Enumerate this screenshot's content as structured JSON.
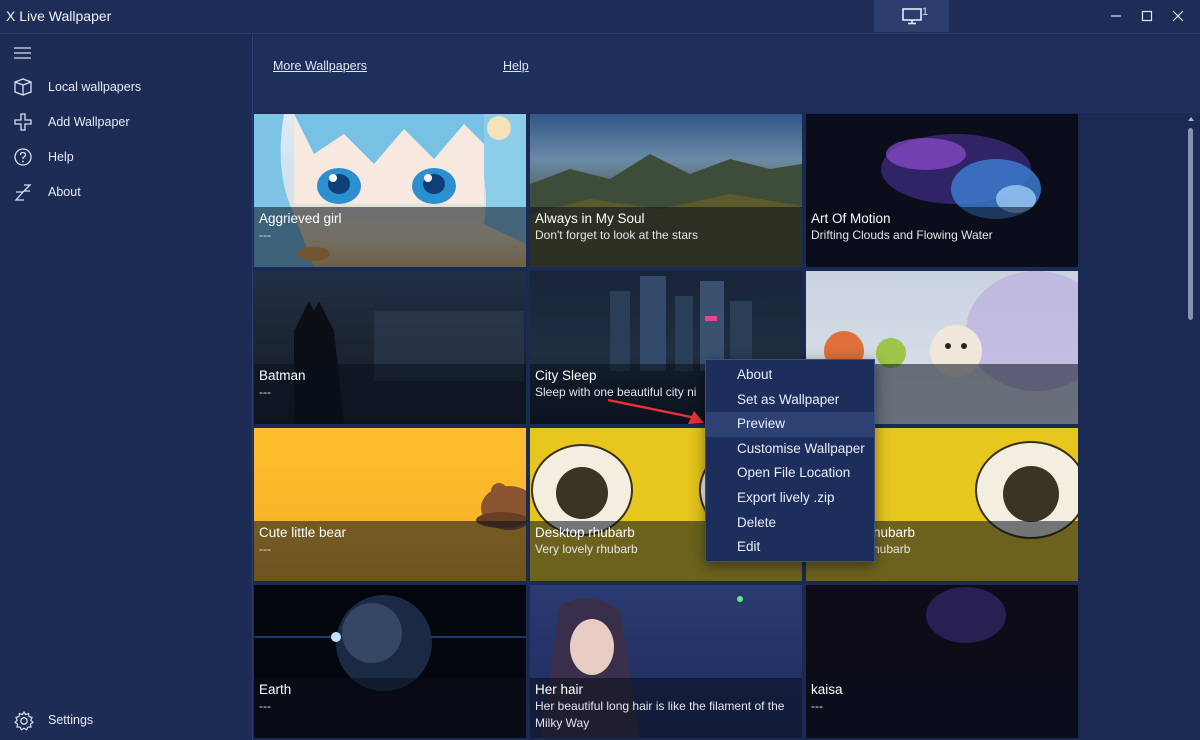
{
  "window": {
    "title": "X Live Wallpaper",
    "monitor_count": "1"
  },
  "sidebar": {
    "items": [
      {
        "label": "Local wallpapers",
        "icon": "book-open-icon"
      },
      {
        "label": "Add Wallpaper",
        "icon": "plus-icon"
      },
      {
        "label": "Help",
        "icon": "help-circle-icon"
      },
      {
        "label": "About",
        "icon": "sleep-z-icon"
      }
    ],
    "settings_label": "Settings"
  },
  "toolbar": {
    "more_wallpapers": "More Wallpapers",
    "help": "Help"
  },
  "wallpapers": [
    {
      "title": "Aggrieved girl",
      "subtitle": "---"
    },
    {
      "title": "Always in My Soul",
      "subtitle": "Don't forget to look at the stars"
    },
    {
      "title": "Art Of Motion",
      "subtitle": "Drifting Clouds and Flowing Water"
    },
    {
      "title": "Batman",
      "subtitle": "---"
    },
    {
      "title": "City Sleep",
      "subtitle": "Sleep with one beautiful city ni"
    },
    {
      "title": "",
      "subtitle": ""
    },
    {
      "title": "Cute little bear",
      "subtitle": "---"
    },
    {
      "title": "Desktop rhubarb",
      "subtitle": "Very lovely rhubarb"
    },
    {
      "title": "hubarb",
      "subtitle": "hubarb"
    },
    {
      "title": "Earth",
      "subtitle": "---"
    },
    {
      "title": "Her hair",
      "subtitle": "Her beautiful long hair is like the filament of the Milky Way"
    },
    {
      "title": "kaisa",
      "subtitle": "---"
    }
  ],
  "context_menu": {
    "items": [
      "About",
      "Set as Wallpaper",
      "Preview",
      "Customise Wallpaper",
      "Open File Location",
      "Export lively .zip",
      "Delete",
      "Edit"
    ],
    "highlighted": "Preview"
  },
  "colors": {
    "accent_arrow": "#e8323a",
    "sidebar_bg": "#1d2c55",
    "main_bg": "#1a2a52"
  }
}
